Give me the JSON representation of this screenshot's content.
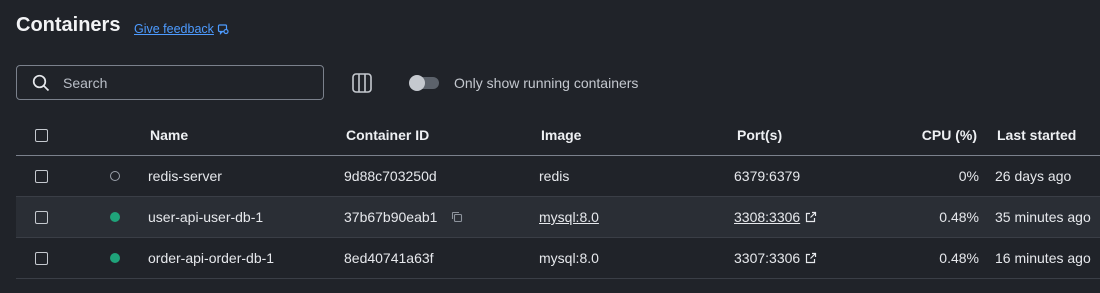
{
  "header": {
    "title": "Containers",
    "feedback_label": "Give feedback"
  },
  "toolbar": {
    "search_placeholder": "Search",
    "toggle_label": "Only show running containers",
    "toggle_on": false
  },
  "table": {
    "columns": {
      "name": "Name",
      "container_id": "Container ID",
      "image": "Image",
      "ports": "Port(s)",
      "cpu": "CPU (%)",
      "last_started": "Last started"
    },
    "rows": [
      {
        "name": "redis-server",
        "status": "stopped",
        "container_id": "9d88c703250d",
        "image": "redis",
        "ports": "6379:6379",
        "cpu": "0%",
        "last_started": "26 days ago"
      },
      {
        "name": "user-api-user-db-1",
        "status": "running",
        "container_id": "37b67b90eab1",
        "image": "mysql:8.0",
        "ports": "3308:3306",
        "cpu": "0.48%",
        "last_started": "35 minutes ago"
      },
      {
        "name": "order-api-order-db-1",
        "status": "running",
        "container_id": "8ed40741a63f",
        "image": "mysql:8.0",
        "ports": "3307:3306",
        "cpu": "0.48%",
        "last_started": "16 minutes ago"
      }
    ]
  },
  "colors": {
    "background": "#202329",
    "accent_link": "#4d9bff",
    "running": "#1fa37a",
    "selected_row": "#2a2e35"
  }
}
